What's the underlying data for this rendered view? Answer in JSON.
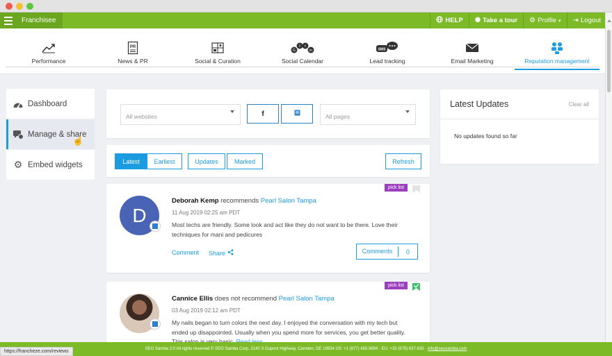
{
  "header": {
    "brand": "Franchisee",
    "actions": [
      {
        "label": "HELP",
        "icon": "globe-icon"
      },
      {
        "label": "Take a tour",
        "icon": "sparkle-icon"
      },
      {
        "label": "Profile",
        "icon": "gear-icon"
      },
      {
        "label": "Logout",
        "icon": "logout-icon"
      }
    ]
  },
  "modules": [
    {
      "label": "Performance",
      "icon": "trend-line-icon"
    },
    {
      "label": "News & PR",
      "icon": "pr-document-icon"
    },
    {
      "label": "Social & Curation",
      "icon": "curation-icon"
    },
    {
      "label": "Social Calendar",
      "icon": "social-networks-icon"
    },
    {
      "label": "Lead tracking",
      "icon": "sms-bubble-icon"
    },
    {
      "label": "Email Marketing",
      "icon": "envelope-icon"
    },
    {
      "label": "Reputation management",
      "icon": "reputation-icon",
      "active": true
    }
  ],
  "left_menu": [
    {
      "label": "Dashboard",
      "icon": "gauge-icon"
    },
    {
      "label": "Manage & share",
      "icon": "manage-icon",
      "active": true
    },
    {
      "label": "Embed widgets",
      "icon": "gear-icon"
    }
  ],
  "filters": {
    "websites_placeholder": "All websites",
    "facebook_label": "f",
    "pages_placeholder": "All pages"
  },
  "tabs": {
    "latest": "Latest",
    "earliest": "Earliest",
    "updates": "Updates",
    "marked": "Marked",
    "refresh": "Refresh"
  },
  "reviews": [
    {
      "badge": "pick list",
      "avatar_letter": "D",
      "author": "Deborah Kemp",
      "verb": "recommends",
      "business": "Pearl Salon Tampa",
      "date": "11 Aug 2019 02:25 am PDT",
      "text": "Most techs are friendly. Some look and act like they do not want to be there. Love their techniques for mani and pedicures",
      "comment_label": "Comment",
      "share_label": "Share",
      "comments_label": "Comments",
      "comments_count": "0"
    },
    {
      "badge": "pick list",
      "author": "Cannice Ellis",
      "verb": "does not recommend",
      "business": "Pearl Salon Tampa",
      "date": "03 Aug 2019 02:12 am PDT",
      "text": "My nails began to turn colors the next day. I enjoyed the conversation with my tech but ended up disappointed. Usually when you spend more for services, you get better quality. This salon is very basic.",
      "read_more": "Read less"
    }
  ],
  "updates": {
    "title": "Latest Updates",
    "clear": "Clear all",
    "empty": "No updates found so far"
  },
  "footer": {
    "text": "SEO Samba 2.0 All rights reserved © SEO Samba Corp. 2140 S Dupont Highway, Camden, DE 19934 US: +1 (877) 450.9894 · EU: +33 (675) 637.635 ·",
    "email": "info@seosamba.com"
  },
  "status_url": "https://francheze.com/reviews",
  "colors": {
    "brand_green": "#7cbb27",
    "accent_blue": "#1b9be0",
    "pick_purple": "#9b3fbf"
  }
}
